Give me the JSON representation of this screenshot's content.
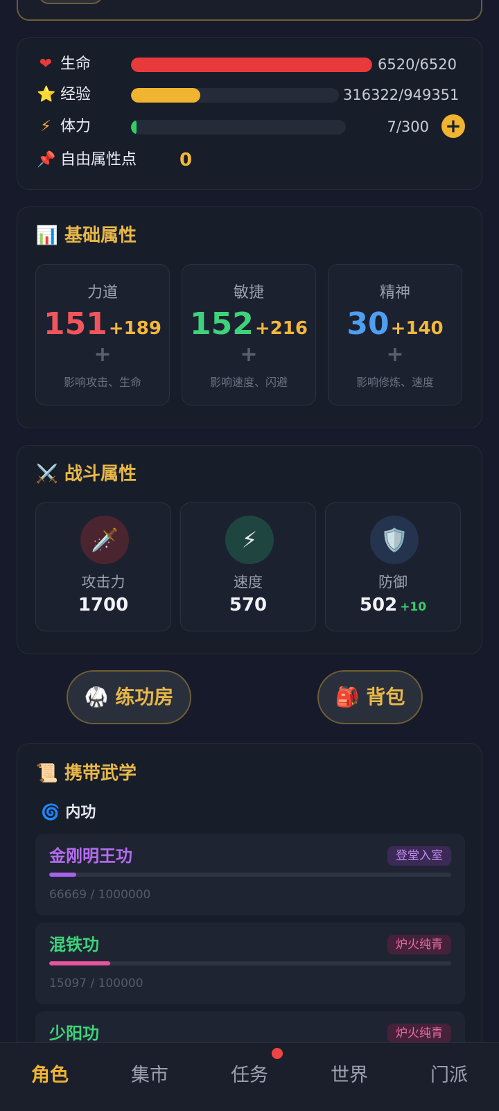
{
  "stats": {
    "hp": {
      "icon": "❤",
      "label": "生命",
      "value": "6520/6520",
      "fill": 1.0,
      "color": "#e83a3a"
    },
    "exp": {
      "icon": "⭐",
      "label": "经验",
      "value": "316322/949351",
      "fill": 0.333,
      "color": "#f0b431"
    },
    "stamina": {
      "icon": "⚡",
      "label": "体力",
      "value": "7/300",
      "fill": 0.023,
      "color": "#2fcf63"
    },
    "stamina_add": "+",
    "free_points": {
      "icon": "📌",
      "label": "自由属性点",
      "value": "0"
    }
  },
  "basic": {
    "icon": "📊",
    "title": "基础属性",
    "items": [
      {
        "name": "力道",
        "base": "151",
        "bonus": "+189",
        "plus": "+",
        "desc": "影响攻击、生命",
        "color": "#f0555d"
      },
      {
        "name": "敏捷",
        "base": "152",
        "bonus": "+216",
        "plus": "+",
        "desc": "影响速度、闪避",
        "color": "#3dd37a"
      },
      {
        "name": "精神",
        "base": "30",
        "bonus": "+140",
        "plus": "+",
        "desc": "影响修炼、速度",
        "color": "#4f9ef0"
      }
    ]
  },
  "combat": {
    "icon": "⚔️",
    "title": "战斗属性",
    "items": [
      {
        "icon": "🗡️",
        "name": "攻击力",
        "value": "1700",
        "bonus": ""
      },
      {
        "icon": "⚡",
        "name": "速度",
        "value": "570",
        "bonus": ""
      },
      {
        "icon": "🛡️",
        "name": "防御",
        "value": "502",
        "bonus": "+10"
      }
    ]
  },
  "actions": {
    "training": {
      "icon": "🥋",
      "label": "练功房"
    },
    "bag": {
      "icon": "🎒",
      "label": "背包"
    }
  },
  "martial": {
    "icon": "📜",
    "title": "携带武学",
    "subsection": {
      "icon": "🌀",
      "label": "内功"
    },
    "skills": [
      {
        "name": "金刚明王功",
        "badge": "登堂入室",
        "progress": "66669 / 1000000",
        "fill": 0.067,
        "name_color": "#b46cf0",
        "bar_color": "#a862e8",
        "badge_bg": "#3a2a55",
        "badge_color": "#c48af2"
      },
      {
        "name": "混铁功",
        "badge": "炉火纯青",
        "progress": "15097 / 100000",
        "fill": 0.151,
        "name_color": "#3dd37a",
        "bar_color": "#e8559a",
        "badge_bg": "#45223a",
        "badge_color": "#ef6aa6"
      },
      {
        "name": "少阳功",
        "badge": "炉火纯青",
        "progress": "",
        "fill": 0,
        "name_color": "#3dd37a",
        "bar_color": "#e8559a",
        "badge_bg": "#45223a",
        "badge_color": "#ef6aa6"
      }
    ]
  },
  "nav": {
    "items": [
      "角色",
      "集市",
      "任务",
      "世界",
      "门派"
    ],
    "active_index": 0,
    "notification_on": "任务"
  }
}
